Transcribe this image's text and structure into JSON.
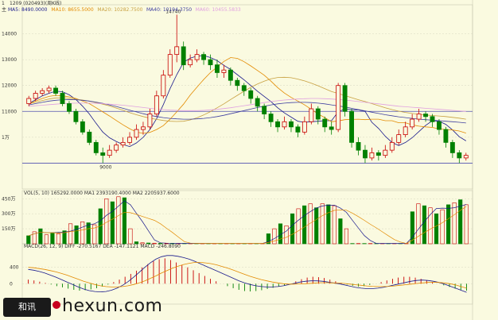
{
  "chart_data": [
    {
      "type": "candlestick",
      "top_label_code": "1",
      "top_label_symbol": "1209 (020493)(周K线)",
      "legend_prefix": "主",
      "legend": [
        {
          "name": "MA5",
          "value": "8490.0000",
          "color": "#1a1a8c"
        },
        {
          "name": "MA10",
          "value": "8655.5000",
          "color": "#e38a00"
        },
        {
          "name": "MA20",
          "value": "10282.7500",
          "color": "#c8a040"
        },
        {
          "name": "MA40",
          "value": "10194.3750",
          "color": "#4040a0"
        },
        {
          "name": "MA60",
          "value": "10455.5833",
          "color": "#e0a0e0"
        }
      ],
      "y_ticks": [
        "14000",
        "13000",
        "12000",
        "11000",
        "1万"
      ],
      "high_label": "14740",
      "low_label": "9000",
      "ylim": [
        8000,
        15000
      ],
      "hline": 11000,
      "candles": [
        [
          11300,
          11500,
          11200,
          11600
        ],
        [
          11500,
          11700,
          11400,
          11800
        ],
        [
          11700,
          11800,
          11600,
          11900
        ],
        [
          11800,
          11900,
          11700,
          12000
        ],
        [
          11900,
          11700,
          11600,
          12000
        ],
        [
          11700,
          11300,
          11200,
          11800
        ],
        [
          11300,
          11000,
          10900,
          11400
        ],
        [
          11000,
          10600,
          10500,
          11100
        ],
        [
          10600,
          10200,
          10100,
          10700
        ],
        [
          10200,
          9800,
          9700,
          10300
        ],
        [
          9800,
          9400,
          9300,
          9900
        ],
        [
          9400,
          9300,
          9000,
          9600
        ],
        [
          9300,
          9500,
          9200,
          9700
        ],
        [
          9500,
          9700,
          9400,
          9800
        ],
        [
          9700,
          9800,
          9600,
          10000
        ],
        [
          9800,
          10000,
          9700,
          10200
        ],
        [
          10000,
          10300,
          9900,
          10500
        ],
        [
          10300,
          10400,
          10100,
          10600
        ],
        [
          10400,
          10900,
          10300,
          11100
        ],
        [
          10900,
          11600,
          10800,
          11800
        ],
        [
          11600,
          12400,
          11500,
          12600
        ],
        [
          12400,
          13200,
          12300,
          13400
        ],
        [
          13200,
          13500,
          12900,
          14740
        ],
        [
          13500,
          12800,
          12600,
          13700
        ],
        [
          12800,
          13000,
          12700,
          13200
        ],
        [
          13000,
          13200,
          12900,
          13400
        ],
        [
          13200,
          13000,
          12800,
          13300
        ],
        [
          13000,
          12800,
          12600,
          13200
        ],
        [
          12800,
          12500,
          12300,
          13000
        ],
        [
          12500,
          12600,
          12300,
          12800
        ],
        [
          12600,
          12200,
          12000,
          12700
        ],
        [
          12200,
          12000,
          11800,
          12300
        ],
        [
          12000,
          11800,
          11600,
          12100
        ],
        [
          11800,
          11500,
          11300,
          11900
        ],
        [
          11500,
          11200,
          11000,
          11600
        ],
        [
          11200,
          10900,
          10700,
          11300
        ],
        [
          10900,
          10600,
          10400,
          11000
        ],
        [
          10600,
          10400,
          10200,
          10700
        ],
        [
          10400,
          10600,
          10300,
          10800
        ],
        [
          10600,
          10400,
          10200,
          10700
        ],
        [
          10400,
          10200,
          10000,
          10500
        ],
        [
          10200,
          10600,
          10100,
          10800
        ],
        [
          10600,
          11100,
          10500,
          11300
        ],
        [
          11100,
          10700,
          10500,
          11200
        ],
        [
          10700,
          10400,
          10200,
          10800
        ],
        [
          10400,
          10300,
          10100,
          10600
        ],
        [
          10300,
          12000,
          10200,
          12100
        ],
        [
          12000,
          11000,
          10800,
          12100
        ],
        [
          11000,
          9800,
          9600,
          11100
        ],
        [
          9800,
          9500,
          9300,
          10000
        ],
        [
          9500,
          9200,
          9000,
          9700
        ],
        [
          9200,
          9400,
          9100,
          9600
        ],
        [
          9400,
          9300,
          9100,
          9500
        ],
        [
          9300,
          9500,
          9200,
          9700
        ],
        [
          9500,
          9800,
          9400,
          10000
        ],
        [
          9800,
          10100,
          9700,
          10300
        ],
        [
          10100,
          10400,
          10000,
          10600
        ],
        [
          10400,
          10700,
          10300,
          10900
        ],
        [
          10700,
          10900,
          10600,
          11100
        ],
        [
          10900,
          10800,
          10600,
          11000
        ],
        [
          10800,
          10600,
          10400,
          10900
        ],
        [
          10600,
          10300,
          10100,
          10700
        ],
        [
          10300,
          9800,
          9600,
          10400
        ],
        [
          9800,
          9400,
          9200,
          9900
        ],
        [
          9400,
          9200,
          9000,
          9500
        ],
        [
          9200,
          9300,
          9100,
          9400
        ]
      ],
      "ma_lines": [
        {
          "name": "MA5",
          "color": "#1a1a8c",
          "values": [
            11300,
            11450,
            11600,
            11700,
            11780,
            11760,
            11640,
            11460,
            11200,
            10900,
            10540,
            10200,
            9980,
            9840,
            9720,
            9640,
            9780,
            10000,
            10300,
            10720,
            11260,
            11880,
            12420,
            12900,
            13060,
            13140,
            13160,
            13080,
            12960,
            12780,
            12620,
            12420,
            12220,
            12000,
            11780,
            11580,
            11380,
            11140,
            10940,
            10780,
            10620,
            10580,
            10600,
            10620,
            10640,
            10640,
            10980,
            11100,
            11060,
            11060,
            11000,
            10580,
            10340,
            10040,
            9800,
            9680,
            9800,
            9980,
            10220,
            10460,
            10640,
            10620,
            10500,
            10280,
            10020,
            9860
          ]
        },
        {
          "name": "MA10",
          "color": "#e38a00",
          "values": [
            11300,
            11400,
            11500,
            11580,
            11620,
            11600,
            11560,
            11500,
            11400,
            11300,
            11140,
            10980,
            10820,
            10650,
            10480,
            10330,
            10200,
            10150,
            10190,
            10300,
            10450,
            10700,
            10980,
            11280,
            11630,
            11940,
            12230,
            12500,
            12720,
            12930,
            13080,
            13050,
            12920,
            12760,
            12580,
            12400,
            12170,
            11920,
            11710,
            11540,
            11400,
            11250,
            11080,
            10900,
            10760,
            10600,
            10630,
            10680,
            10690,
            10700,
            10680,
            10700,
            10700,
            10640,
            10640,
            10560,
            10560,
            10480,
            10430,
            10400,
            10380,
            10320,
            10300,
            10280,
            10240,
            10160
          ]
        },
        {
          "name": "MA20",
          "color": "#c8a040",
          "values": [
            11300,
            11350,
            11420,
            11480,
            11520,
            11520,
            11500,
            11470,
            11440,
            11400,
            11340,
            11280,
            11210,
            11130,
            11050,
            10950,
            10870,
            10800,
            10740,
            10690,
            10650,
            10620,
            10610,
            10620,
            10670,
            10750,
            10860,
            10990,
            11140,
            11290,
            11460,
            11620,
            11780,
            11930,
            12060,
            12170,
            12260,
            12310,
            12320,
            12300,
            12250,
            12180,
            12090,
            11990,
            11880,
            11770,
            11690,
            11610,
            11530,
            11450,
            11380,
            11300,
            11220,
            11140,
            11070,
            11010,
            10960,
            10920,
            10890,
            10860,
            10840,
            10820,
            10800,
            10770,
            10740,
            10700
          ]
        },
        {
          "name": "MA40",
          "color": "#4040a0",
          "values": [
            11250,
            11300,
            11350,
            11400,
            11430,
            11450,
            11460,
            11450,
            11430,
            11400,
            11360,
            11310,
            11250,
            11190,
            11120,
            11050,
            10980,
            10910,
            10850,
            10800,
            10760,
            10730,
            10710,
            10700,
            10700,
            10710,
            10730,
            10760,
            10800,
            10850,
            10910,
            10970,
            11030,
            11090,
            11150,
            11200,
            11250,
            11290,
            11320,
            11340,
            11350,
            11350,
            11340,
            11320,
            11290,
            11250,
            11210,
            11170,
            11120,
            11070,
            11020,
            10970,
            10920,
            10870,
            10830,
            10790,
            10760,
            10730,
            10700,
            10680,
            10660,
            10640,
            10620,
            10600,
            10580,
            10550
          ]
        },
        {
          "name": "MA60",
          "color": "#e0a0e0",
          "values": [
            11200,
            11220,
            11240,
            11260,
            11280,
            11300,
            11310,
            11320,
            11320,
            11320,
            11310,
            11300,
            11280,
            11260,
            11240,
            11210,
            11180,
            11150,
            11120,
            11090,
            11070,
            11050,
            11040,
            11030,
            11030,
            11030,
            11040,
            11060,
            11080,
            11110,
            11140,
            11180,
            11220,
            11260,
            11300,
            11340,
            11380,
            11410,
            11440,
            11460,
            11480,
            11490,
            11500,
            11500,
            11490,
            11480,
            11460,
            11440,
            11410,
            11380,
            11350,
            11320,
            11290,
            11260,
            11230,
            11200,
            11180,
            11160,
            11140,
            11120,
            11100,
            11080,
            11060,
            11040,
            11020,
            11000
          ]
        }
      ]
    },
    {
      "type": "bar",
      "legend_text": "VOL(5, 10)  165292.0000  MA1 2393190.4000  MA2 2205937.6000",
      "y_ticks": [
        "450万",
        "300万",
        "150万"
      ],
      "ylim": [
        0,
        5000000
      ],
      "values": [
        800000,
        1200000,
        1500000,
        900000,
        1100000,
        1000000,
        1300000,
        2000000,
        1800000,
        2200000,
        2100000,
        1900000,
        3500000,
        4500000,
        4200000,
        4700000,
        4600000,
        1500000,
        200000,
        100000,
        80000,
        60000,
        50000,
        40000,
        30000,
        30000,
        30000,
        30000,
        30000,
        30000,
        30000,
        30000,
        30000,
        30000,
        30000,
        30000,
        30000,
        30000,
        30000,
        30000,
        1000000,
        1500000,
        2000000,
        1800000,
        3000000,
        3500000,
        3800000,
        4000000,
        3600000,
        4000000,
        3900000,
        3800000,
        2500000,
        1500000,
        30000,
        30000,
        30000,
        30000,
        30000,
        30000,
        30000,
        30000,
        30000,
        30000,
        3200000,
        4000000,
        3800000,
        3600000,
        3000000,
        3400000,
        3900000,
        4100000,
        4400000,
        3900000
      ]
    },
    {
      "type": "line",
      "legend_text": "MACD(26, 12, 9)  DIFF -270.5167  DEA -147.1121  MACD -246.8090",
      "y_ticks": [
        "400",
        "0"
      ],
      "ylim": [
        -500,
        900
      ],
      "macd_bars": [
        100,
        80,
        50,
        20,
        -20,
        -60,
        -90,
        -120,
        -150,
        -170,
        -160,
        -140,
        -110,
        -70,
        -20,
        40,
        100,
        170,
        240,
        320,
        400,
        480,
        550,
        600,
        620,
        580,
        520,
        460,
        400,
        330,
        260,
        190,
        120,
        60,
        0,
        -60,
        -110,
        -150,
        -180,
        -190,
        -180,
        -160,
        -130,
        -100,
        -70,
        -40,
        0,
        60,
        110,
        150,
        170,
        160,
        140,
        100,
        60,
        20,
        -20,
        -50,
        -70,
        -60,
        -30,
        0,
        40,
        80,
        120,
        150,
        170,
        170,
        150,
        120,
        80,
        40,
        0,
        -40,
        -80,
        -120,
        -150,
        -170
      ],
      "diff": [
        350,
        330,
        300,
        260,
        210,
        160,
        100,
        40,
        -20,
        -80,
        -130,
        -170,
        -190,
        -200,
        -190,
        -160,
        -110,
        -40,
        50,
        160,
        280,
        400,
        510,
        600,
        660,
        690,
        690,
        670,
        640,
        600,
        550,
        490,
        430,
        370,
        310,
        250,
        190,
        130,
        70,
        20,
        -20,
        -50,
        -70,
        -80,
        -80,
        -70,
        -50,
        -20,
        10,
        40,
        60,
        70,
        70,
        60,
        40,
        20,
        0,
        -30,
        -60,
        -90,
        -110,
        -120,
        -120,
        -110,
        -90,
        -60,
        -30,
        0,
        30,
        60,
        80,
        90,
        80,
        60,
        30,
        -10,
        -60,
        -110,
        -160,
        -210
      ],
      "dea": [
        400,
        390,
        370,
        350,
        320,
        290,
        250,
        210,
        160,
        110,
        60,
        20,
        -20,
        -50,
        -70,
        -80,
        -80,
        -70,
        -50,
        -20,
        20,
        70,
        130,
        190,
        260,
        320,
        380,
        430,
        470,
        500,
        520,
        520,
        510,
        490,
        460,
        420,
        380,
        330,
        280,
        230,
        180,
        140,
        100,
        70,
        40,
        20,
        0,
        -10,
        -10,
        -5,
        0,
        10,
        20,
        25,
        25,
        20,
        15,
        5,
        -10,
        -25,
        -40,
        -55,
        -65,
        -70,
        -70,
        -65,
        -55,
        -40,
        -25,
        -10,
        5,
        20,
        30,
        35,
        30,
        20,
        0,
        -30,
        -70,
        -110
      ]
    }
  ],
  "watermark": {
    "badge": "和讯",
    "text": "hexun.com"
  }
}
